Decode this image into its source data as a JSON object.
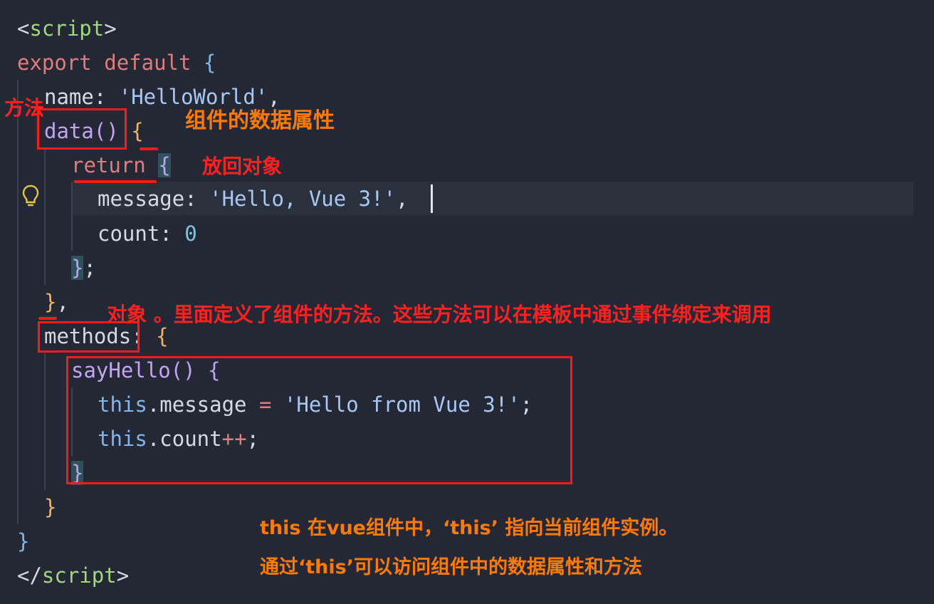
{
  "code": {
    "l1_open": "<",
    "l1_tag": "script",
    "l1_close": ">",
    "l2_export": "export",
    "l2_default": "default",
    "l2_brace": "{",
    "l3_name": "name",
    "l3_colon": ": ",
    "l3_value": "'HelloWorld'",
    "l3_comma": ",",
    "l4_fn": "data()",
    "l4_brace": "{",
    "l5_return": "return",
    "l5_brace": "{",
    "l6_key": "message",
    "l6_colon": ": ",
    "l6_value": "'Hello, Vue 3!'",
    "l6_comma": ",",
    "l7_key": "count",
    "l7_colon": ": ",
    "l7_value": "0",
    "l8_brace": "}",
    "l8_semi": ";",
    "l9_brace": "}",
    "l9_comma": ",",
    "l10_key": "methods",
    "l10_colon": ": ",
    "l10_brace": "{",
    "l11_fn": "sayHello()",
    "l11_brace": "{",
    "l12_this": "this",
    "l12_prop": ".message ",
    "l12_op": "=",
    "l12_value": "'Hello from Vue 3!'",
    "l12_semi": ";",
    "l13_this": "this",
    "l13_prop": ".count",
    "l13_op": "++",
    "l13_semi": ";",
    "l14_brace": "}",
    "l15_brace": "}",
    "l16_brace": "}",
    "l17_open": "</",
    "l17_tag": "script",
    "l17_close": ">"
  },
  "annotations": {
    "method_label": "方法",
    "data_props": "组件的数据属性",
    "return_obj": "放回对象",
    "methods_desc": "对象 。里面定义了组件的方法。这些方法可以在模板中通过事件绑定来调用",
    "this_line1": "this 在vue组件中，‘this’ 指向当前组件实例。",
    "this_line2": "通过‘this’可以访问组件中的数据属性和方法"
  },
  "colors": {
    "background": "#232834",
    "annotation_red": "#ff1a1a",
    "annotation_orange": "#ff7a00"
  }
}
